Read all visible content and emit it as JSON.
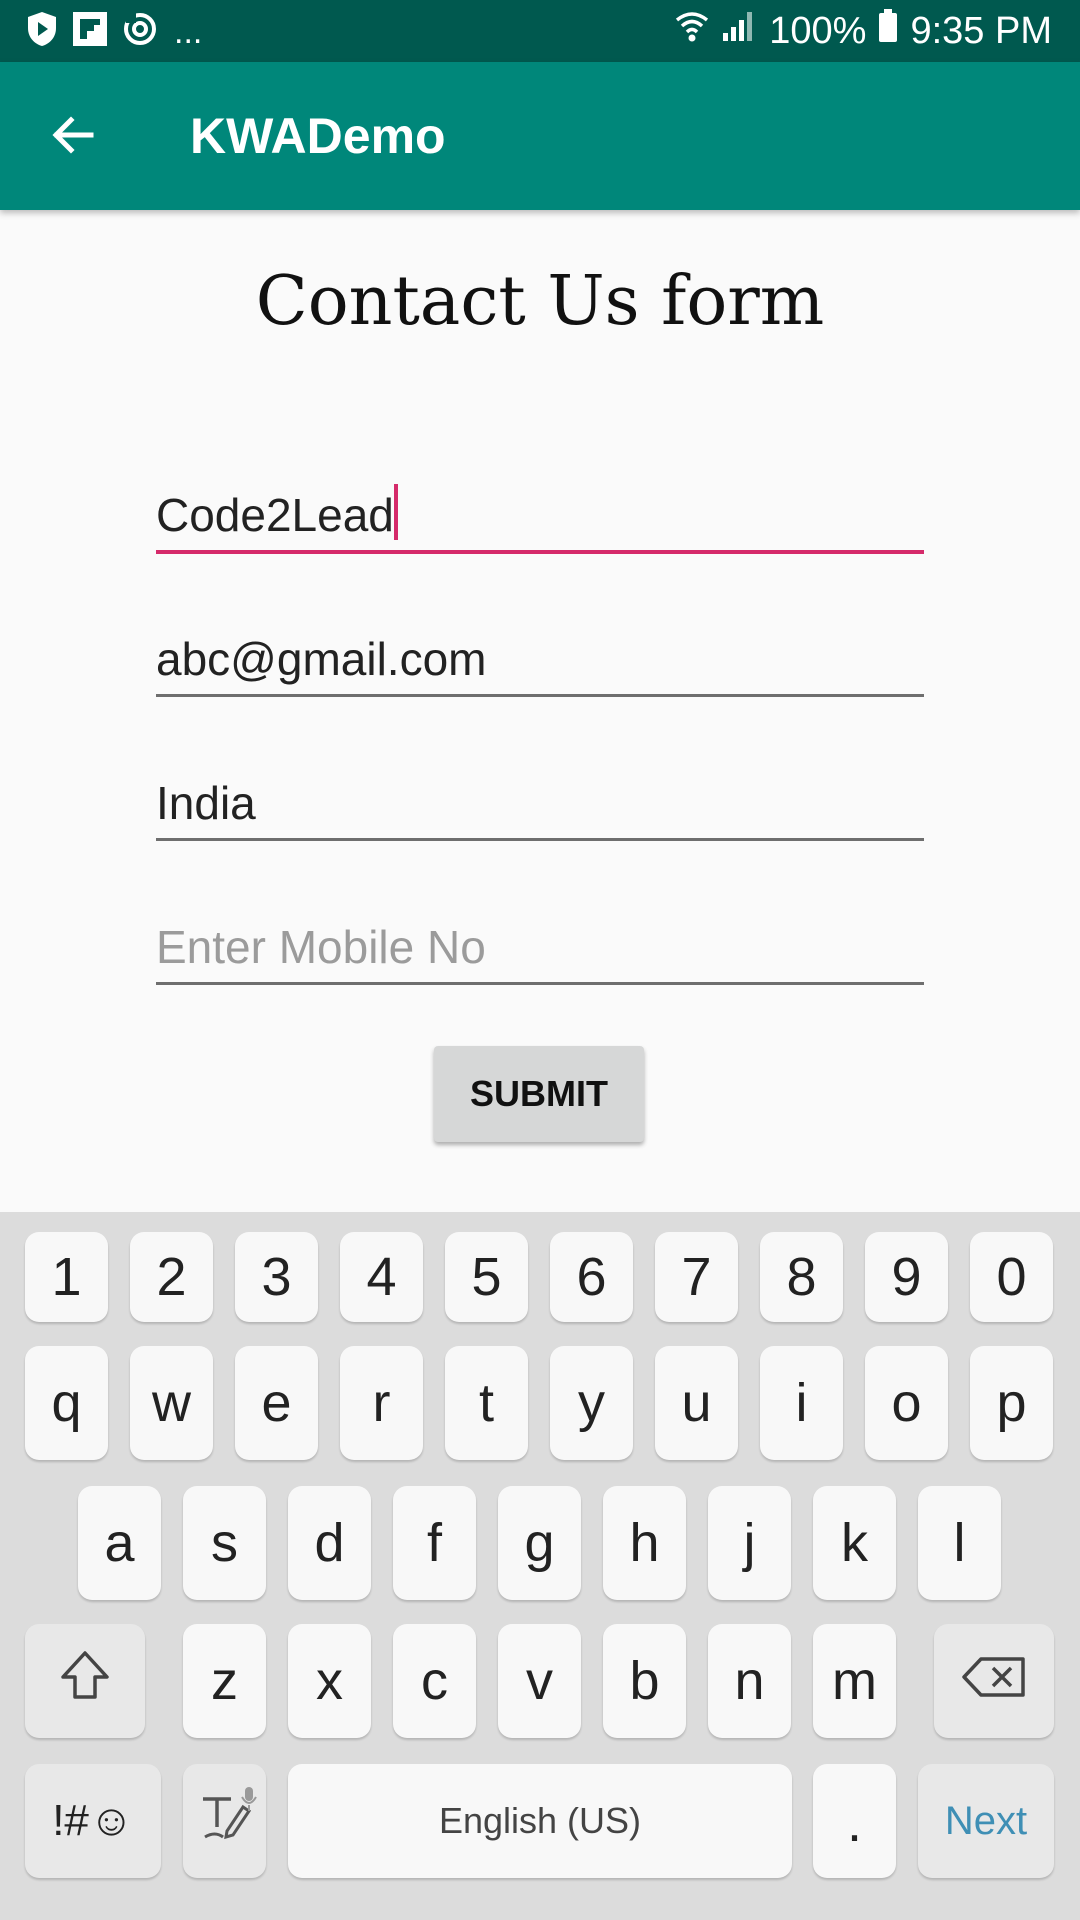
{
  "status_bar": {
    "ellipsis": "...",
    "battery": "100%",
    "time": "9:35 PM"
  },
  "app_bar": {
    "title": "KWADemo"
  },
  "form": {
    "title": "Contact Us form",
    "fields": [
      {
        "value": "Code2Lead",
        "placeholder": ""
      },
      {
        "value": "abc@gmail.com",
        "placeholder": ""
      },
      {
        "value": "India",
        "placeholder": ""
      },
      {
        "value": "",
        "placeholder": "Enter Mobile No"
      }
    ],
    "submit_label": "SUBMIT"
  },
  "keyboard": {
    "row_numbers": [
      "1",
      "2",
      "3",
      "4",
      "5",
      "6",
      "7",
      "8",
      "9",
      "0"
    ],
    "row_1": [
      "q",
      "w",
      "e",
      "r",
      "t",
      "y",
      "u",
      "i",
      "o",
      "p"
    ],
    "row_2": [
      "a",
      "s",
      "d",
      "f",
      "g",
      "h",
      "j",
      "k",
      "l"
    ],
    "row_3": [
      "z",
      "x",
      "c",
      "v",
      "b",
      "n",
      "m"
    ],
    "symbols_label": "!#☺",
    "space_label": "English (US)",
    "period_label": ".",
    "next_label": "Next"
  },
  "colors": {
    "status_bar": "#00594f",
    "app_bar": "#00877a",
    "accent": "#d52a6a",
    "next_key": "#3f8fb5"
  }
}
